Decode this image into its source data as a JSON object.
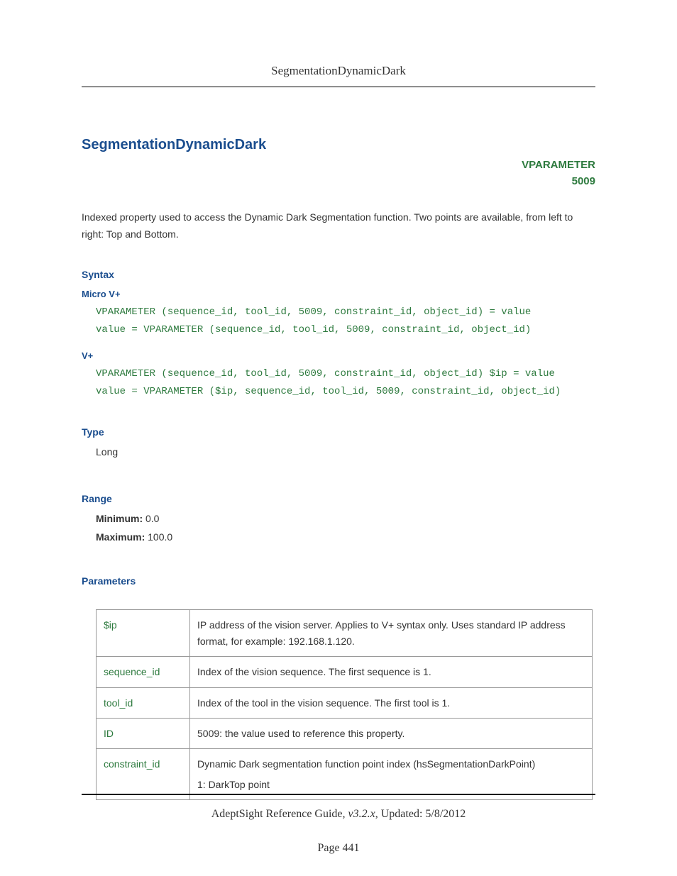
{
  "header": {
    "title": "SegmentationDynamicDark"
  },
  "main": {
    "heading": "SegmentationDynamicDark",
    "param_label_line1": "VPARAMETER",
    "param_label_line2": "5009",
    "description": "Indexed property used to access the Dynamic Dark Segmentation function. Two points are available, from left to right: Top and Bottom."
  },
  "syntax": {
    "heading": "Syntax",
    "micro_heading": "Micro V+",
    "micro_code": "VPARAMETER (sequence_id, tool_id, 5009, constraint_id, object_id) = value\nvalue = VPARAMETER (sequence_id, tool_id, 5009, constraint_id, object_id)",
    "vplus_heading": "V+",
    "vplus_code": "VPARAMETER (sequence_id, tool_id, 5009, constraint_id, object_id) $ip = value\nvalue = VPARAMETER ($ip, sequence_id, tool_id, 5009, constraint_id, object_id)"
  },
  "type": {
    "heading": "Type",
    "value": "Long"
  },
  "range": {
    "heading": "Range",
    "min_label": "Minimum:",
    "min_value": " 0.0",
    "max_label": "Maximum:",
    "max_value": " 100.0"
  },
  "parameters": {
    "heading": "Parameters",
    "rows": [
      {
        "name": "$ip",
        "desc": "IP address of the vision server. Applies to V+ syntax only. Uses standard IP address format, for example: 192.168.1.120."
      },
      {
        "name": "sequence_id",
        "desc": "Index of the vision sequence. The first sequence is 1."
      },
      {
        "name": "tool_id",
        "desc": "Index of the tool in the vision sequence. The first tool is 1."
      },
      {
        "name": "ID",
        "desc": "5009: the value used to reference this property."
      },
      {
        "name": "constraint_id",
        "desc": "Dynamic Dark segmentation function point index (hsSegmentationDarkPoint)\n1: DarkTop point"
      }
    ]
  },
  "footer": {
    "guide": "AdeptSight Reference Guide",
    "version": ", v3.2.x",
    "updated": ", Updated: 5/8/2012",
    "page": "Page 441"
  }
}
